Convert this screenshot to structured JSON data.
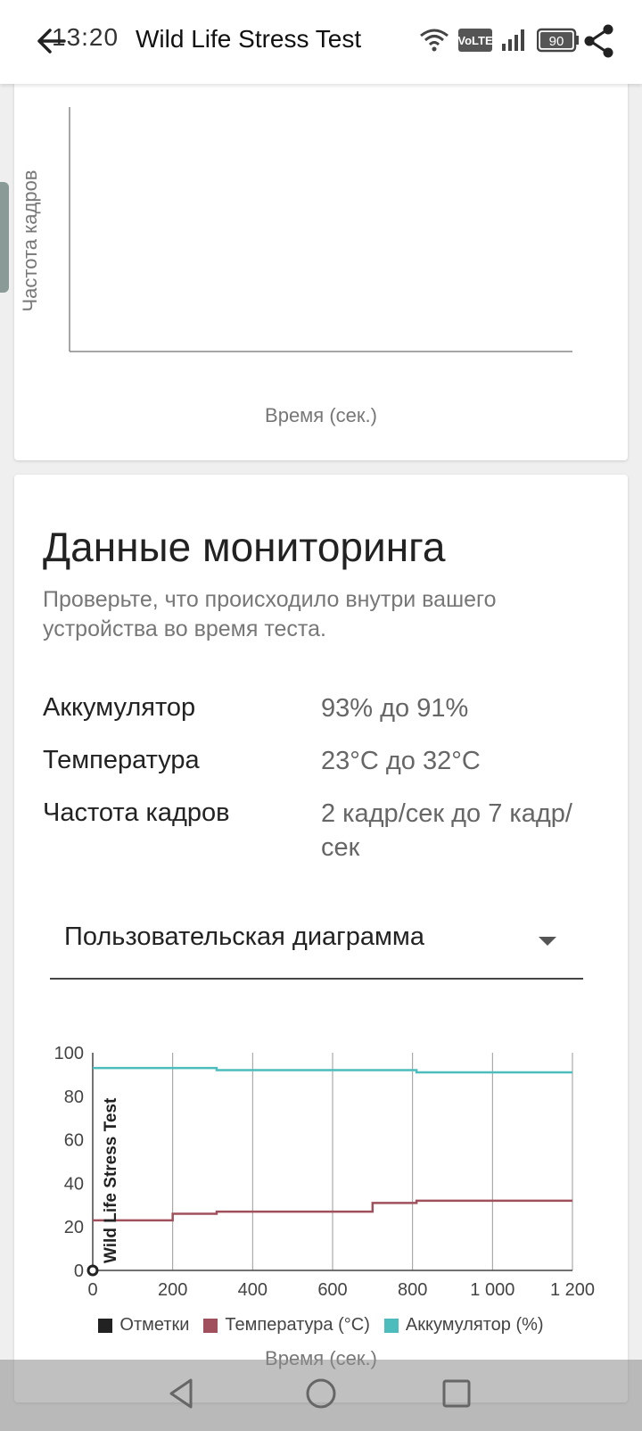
{
  "status_bar": {
    "time": "13:20",
    "battery": "90"
  },
  "app": {
    "title": "Wild Life Stress Test"
  },
  "chart1": {
    "ylabel": "Частота кадров",
    "xlabel": "Время (сек.)"
  },
  "monitoring": {
    "title": "Данные мониторинга",
    "description": "Проверьте, что происходило внутри вашего устройства во время теста.",
    "rows": [
      {
        "label": "Аккумулятор",
        "value": "93% до 91%"
      },
      {
        "label": "Температура",
        "value": "23°C до 32°C"
      },
      {
        "label": "Частота кадров",
        "value": "2 кадр/сек до 7 кадр/сек"
      }
    ],
    "dropdown_label": "Пользовательская диаграмма"
  },
  "chart_data": {
    "type": "line",
    "xlabel": "Время (сек.)",
    "ylabel": "",
    "xlim": [
      0,
      1200
    ],
    "ylim": [
      0,
      100
    ],
    "x_ticks": [
      "0",
      "200",
      "400",
      "600",
      "800",
      "1 000",
      "1 200"
    ],
    "y_ticks": [
      "0",
      "20",
      "40",
      "60",
      "80",
      "100"
    ],
    "marker_label": "Wild Life Stress Test",
    "series": [
      {
        "name": "Температура (°C)",
        "color": "#a0505c",
        "x": [
          0,
          200,
          200,
          310,
          310,
          700,
          700,
          810,
          810,
          1200
        ],
        "y": [
          23,
          23,
          26,
          26,
          27,
          27,
          31,
          31,
          32,
          32
        ]
      },
      {
        "name": "Аккумулятор (%)",
        "color": "#4dbcbc",
        "x": [
          0,
          310,
          310,
          810,
          810,
          1200
        ],
        "y": [
          93,
          93,
          92,
          92,
          91,
          91
        ]
      }
    ],
    "legend": [
      {
        "label": "Отметки",
        "color": "#222222"
      },
      {
        "label": "Температура (°C)",
        "color": "#a0505c"
      },
      {
        "label": "Аккумулятор (%)",
        "color": "#4dbcbc"
      }
    ]
  }
}
